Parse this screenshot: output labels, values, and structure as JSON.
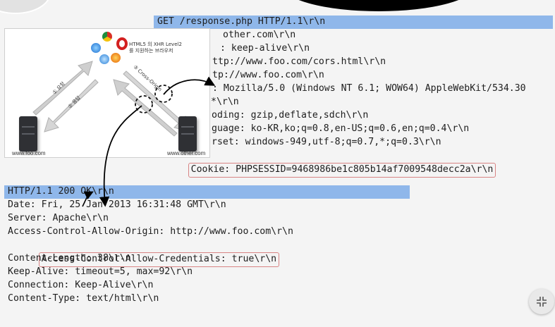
{
  "request": {
    "header": "GET /response.php HTTP/1.1\\r\\n",
    "lines": [
      "other.com\\r\\n",
      ": keep-alive\\r\\n",
      "ttp://www.foo.com/cors.html\\r\\n",
      "tp://www.foo.com\\r\\n",
      ": Mozilla/5.0 (Windows NT 6.1; WOW64) AppleWebKit/534.30",
      "*\\r\\n",
      "oding: gzip,deflate,sdch\\r\\n",
      "guage: ko-KR,ko;q=0.8,en-US;q=0.6,en;q=0.4\\r\\n",
      "rset: windows-949,utf-8;q=0.7,*;q=0.3\\r\\n"
    ],
    "cookie": "Cookie: PHPSESSID=9468986be1c805b14af7009548decc2a\\r\\n"
  },
  "response": {
    "header": "HTTP/1.1 200 OK\\r\\n",
    "lines": [
      "Date: Fri, 25 Jan 2013 16:31:48 GMT\\r\\n",
      "Server: Apache\\r\\n",
      "Access-Control-Allow-Origin: http://www.foo.com\\r\\n"
    ],
    "credentials": "Access-Control-Allow-Credentials: true\\r\\n",
    "lines_after": [
      "Content-Length: 38\\r\\n",
      "Keep-Alive: timeout=5, max=92\\r\\n",
      "Connection: Keep-Alive\\r\\n",
      "Content-Type: text/html\\r\\n"
    ]
  },
  "diagram": {
    "browser_caption_line1": "HTML5 의 XHR Level2",
    "browser_caption_line2": "를 지원하는 브라우저",
    "label_request": "① 요청",
    "label_response": "② 응답",
    "label_cross": "③ Cross-Origin",
    "server_left": "www.foo.com",
    "server_right": "www.other.com"
  },
  "colors": {
    "header_bar": "#8fb7ea",
    "highlight_border": "#d88484"
  },
  "icons": {
    "collapse": "collapse-icon"
  }
}
